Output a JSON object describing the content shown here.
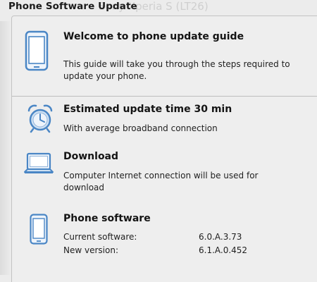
{
  "window": {
    "title": "Phone Software Update",
    "background_text": "Sony Xperia S (LT26)"
  },
  "welcome": {
    "icon": "phone-icon",
    "heading": "Welcome to phone update guide",
    "text": "This guide will take you through the steps required to update your phone."
  },
  "estimate": {
    "icon": "alarm-clock-icon",
    "heading": "Estimated update time 30 min",
    "text": "With average broadband connection"
  },
  "download": {
    "icon": "laptop-icon",
    "heading": "Download",
    "text": "Computer Internet connection will be used for download"
  },
  "software": {
    "icon": "phone-icon",
    "heading": "Phone software",
    "current_label": "Current software:",
    "current_value": "6.0.A.3.73",
    "new_label": "New version:",
    "new_value": "6.1.A.0.452"
  },
  "colors": {
    "icon_blue": "#4a86c5",
    "icon_light": "#cfe1f3"
  }
}
